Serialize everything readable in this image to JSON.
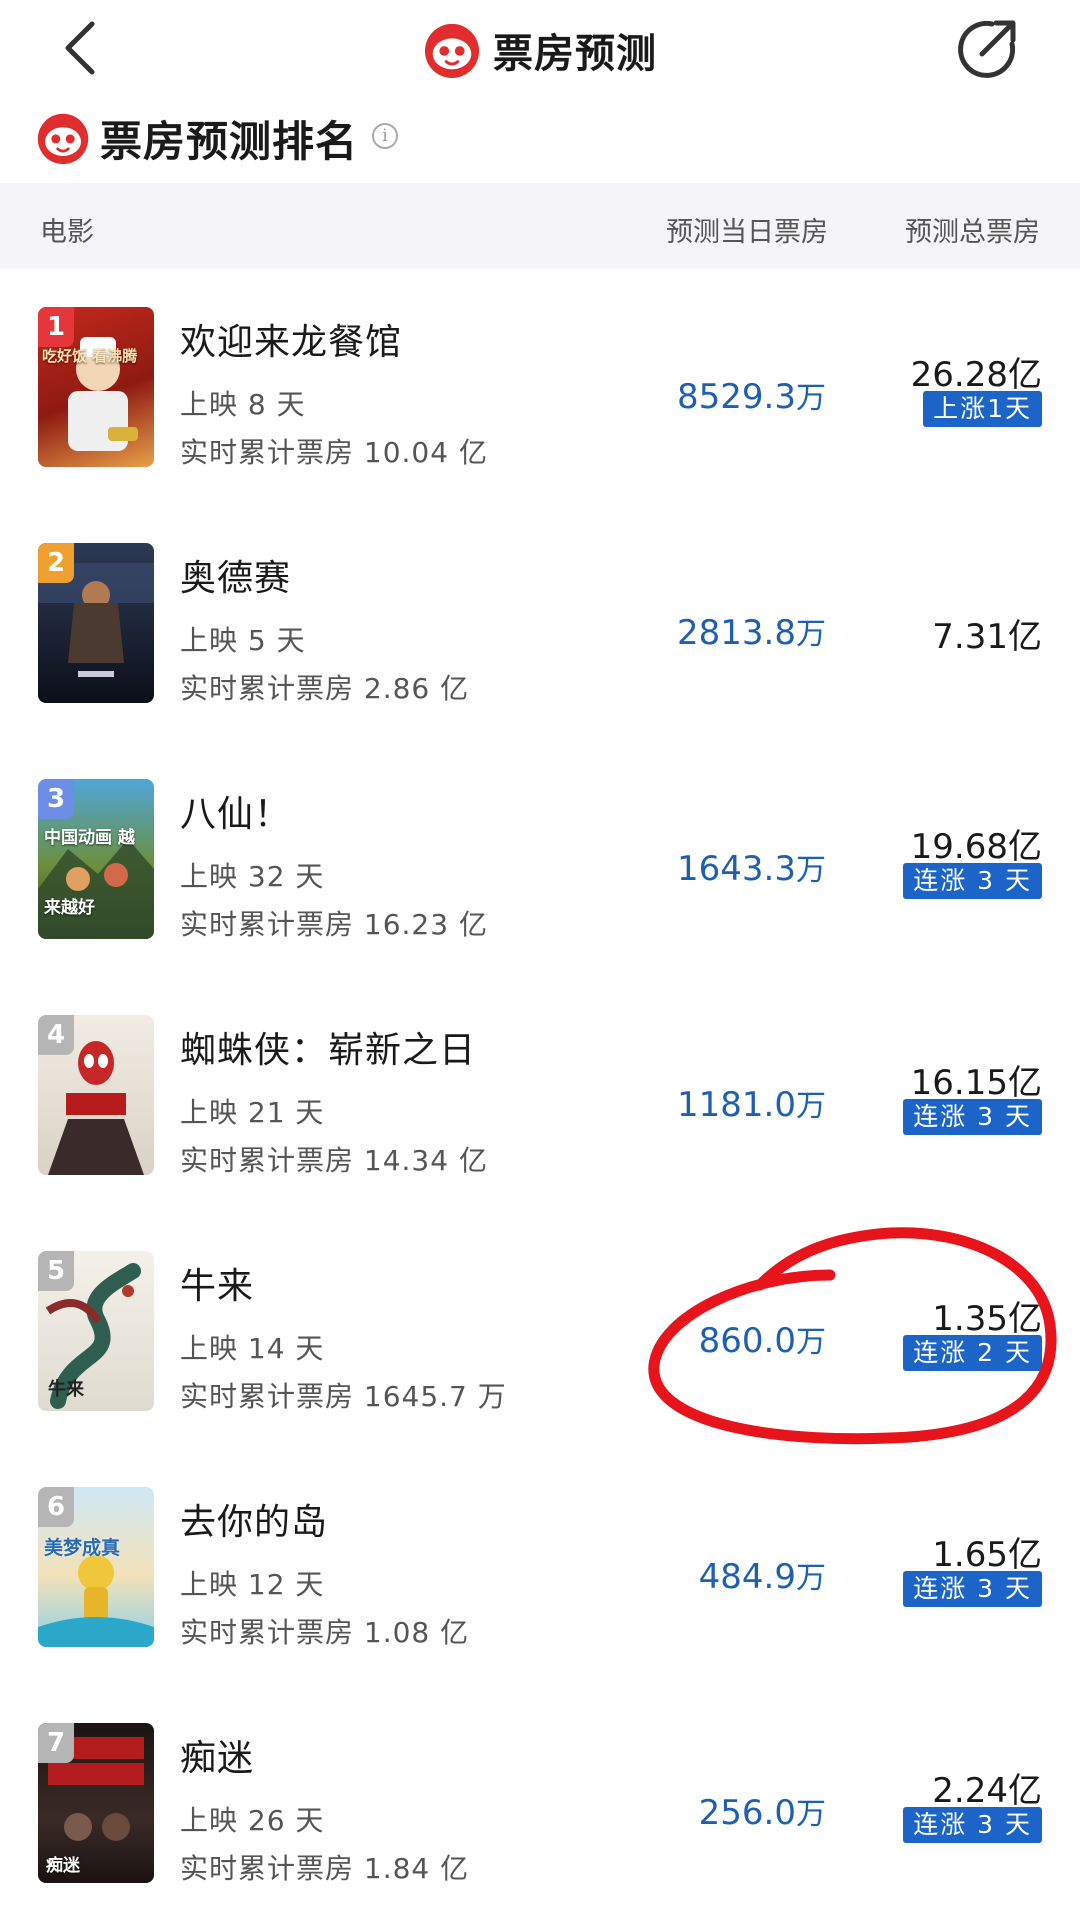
{
  "header": {
    "title": "票房预测",
    "back_icon": "chevron-left-icon",
    "share_icon": "share-icon",
    "logo_icon": "maoyan-cat-logo"
  },
  "section": {
    "title": "票房预测排名",
    "info_icon": "info-icon",
    "info_glyph": "i"
  },
  "table": {
    "columns": [
      "电影",
      "预测当日票房",
      "预测总票房"
    ]
  },
  "colors": {
    "brand_red": "#e02e2e",
    "value_blue": "#1f5fb3",
    "trend_blue": "#1c64c8",
    "rank_red": "#e5373b",
    "rank_orange": "#f0a030",
    "rank_blue": "#6c8ee6",
    "rank_gray": "#b5b5b5",
    "annotation_red": "#e8141b"
  },
  "movies": [
    {
      "rank": "1",
      "title": "欢迎来龙餐馆",
      "days": "上映 8 天",
      "cumulative": "实时累计票房 10.04 亿",
      "day_value": "8529.3",
      "day_unit": "万",
      "total": "26.28亿",
      "trend": "上涨1天",
      "poster_text": "吃好饭 看沸腾"
    },
    {
      "rank": "2",
      "title": "奥德赛",
      "days": "上映 5 天",
      "cumulative": "实时累计票房 2.86 亿",
      "day_value": "2813.8",
      "day_unit": "万",
      "total": "7.31亿",
      "trend": "",
      "poster_text": ""
    },
    {
      "rank": "3",
      "title": "八仙！",
      "days": "上映 32 天",
      "cumulative": "实时累计票房 16.23 亿",
      "day_value": "1643.3",
      "day_unit": "万",
      "total": "19.68亿",
      "trend": "连涨 3 天",
      "poster_text": "中国动画 越来越好"
    },
    {
      "rank": "4",
      "title": "蜘蛛侠：崭新之日",
      "days": "上映 21 天",
      "cumulative": "实时累计票房 14.34 亿",
      "day_value": "1181.0",
      "day_unit": "万",
      "total": "16.15亿",
      "trend": "连涨 3 天",
      "poster_text": ""
    },
    {
      "rank": "5",
      "title": "牛来",
      "days": "上映 14 天",
      "cumulative": "实时累计票房 1645.7 万",
      "day_value": "860.0",
      "day_unit": "万",
      "total": "1.35亿",
      "trend": "连涨 2 天",
      "poster_text": "牛来"
    },
    {
      "rank": "6",
      "title": "去你的岛",
      "days": "上映 12 天",
      "cumulative": "实时累计票房 1.08 亿",
      "day_value": "484.9",
      "day_unit": "万",
      "total": "1.65亿",
      "trend": "连涨 3 天",
      "poster_text": "美梦成真"
    },
    {
      "rank": "7",
      "title": "痴迷",
      "days": "上映 26 天",
      "cumulative": "实时累计票房 1.84 亿",
      "day_value": "256.0",
      "day_unit": "万",
      "total": "2.24亿",
      "trend": "连涨 3 天",
      "poster_text": "痴迷"
    }
  ]
}
